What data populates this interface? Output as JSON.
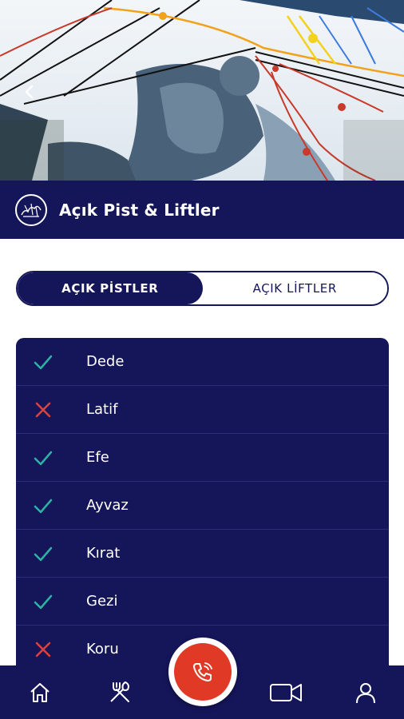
{
  "hero": {
    "image": "ski-resort-trail-map"
  },
  "header": {
    "title": "Açık Pist & Liftler",
    "icon": "trail-map-icon"
  },
  "tabs": [
    {
      "label": "AÇIK PİSTLER",
      "active": true
    },
    {
      "label": "AÇIK LİFTLER",
      "active": false
    }
  ],
  "pistes": [
    {
      "name": "Dede",
      "open": true
    },
    {
      "name": "Latif",
      "open": false
    },
    {
      "name": "Efe",
      "open": true
    },
    {
      "name": "Ayvaz",
      "open": true
    },
    {
      "name": "Kırat",
      "open": true
    },
    {
      "name": "Gezi",
      "open": true
    },
    {
      "name": "Koru",
      "open": false
    }
  ],
  "nav": {
    "items": [
      "home-icon",
      "restaurant-icon",
      "emergency-call-icon",
      "video-camera-icon",
      "user-icon"
    ]
  },
  "colors": {
    "primary": "#15155a",
    "open": "#2bb3a3",
    "closed": "#e0413a",
    "call": "#e03a26"
  }
}
